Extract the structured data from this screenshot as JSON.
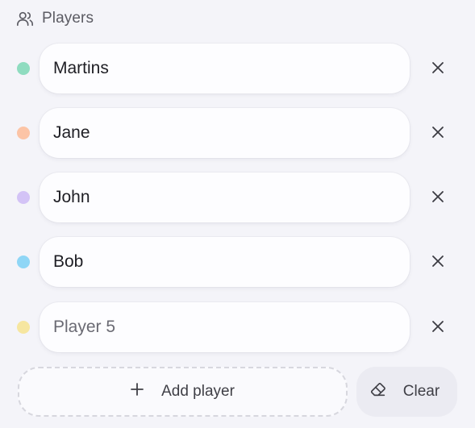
{
  "header": {
    "title": "Players",
    "icon": "users-icon"
  },
  "players": [
    {
      "value": "Martins",
      "placeholder": "",
      "color": "#8fdcc0"
    },
    {
      "value": "Jane",
      "placeholder": "",
      "color": "#fcc4a6"
    },
    {
      "value": "John",
      "placeholder": "",
      "color": "#d3c3f6"
    },
    {
      "value": "Bob",
      "placeholder": "",
      "color": "#8fd6f6"
    },
    {
      "value": "",
      "placeholder": "Player 5",
      "color": "#f6e6a0"
    }
  ],
  "remove_icon": "close-icon",
  "actions": {
    "add_label": "Add player",
    "add_icon": "plus-icon",
    "clear_label": "Clear",
    "clear_icon": "eraser-icon"
  }
}
